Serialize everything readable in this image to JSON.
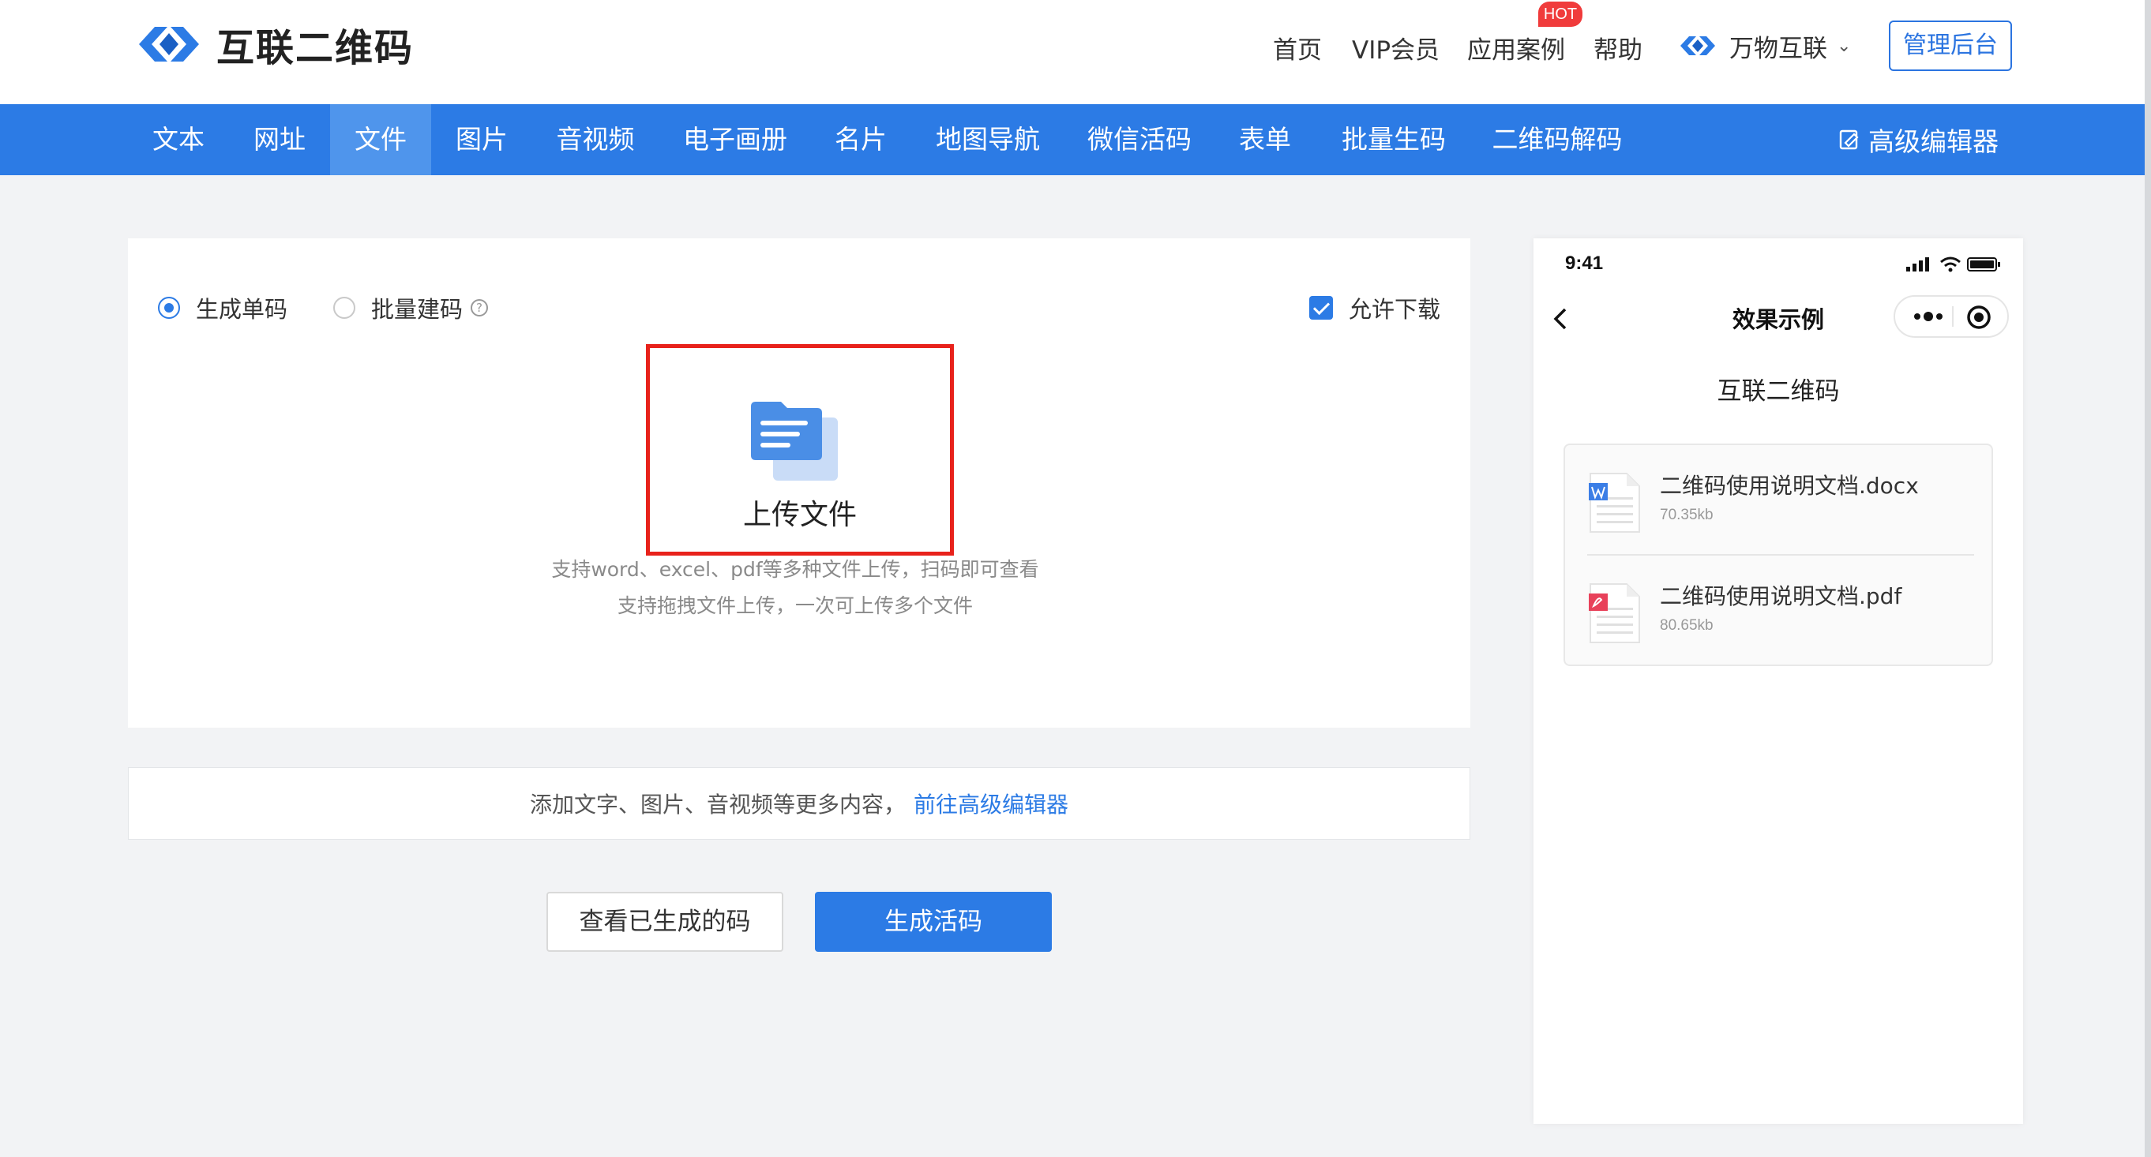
{
  "header": {
    "logo_text": "互联二维码",
    "nav": [
      "首页",
      "VIP会员",
      "应用案例",
      "帮助"
    ],
    "hot_badge": "HOT",
    "brand2": "万物互联",
    "admin_button": "管理后台"
  },
  "tabs": {
    "items": [
      "文本",
      "网址",
      "文件",
      "图片",
      "音视频",
      "电子画册",
      "名片",
      "地图导航",
      "微信活码",
      "表单",
      "批量生码",
      "二维码解码"
    ],
    "active": "文件",
    "advanced_editor": "高级编辑器"
  },
  "upload": {
    "radio_single": "生成单码",
    "radio_batch": "批量建码",
    "allow_download": "允许下载",
    "upload_label": "上传文件",
    "hint_1": "支持word、excel、pdf等多种文件上传，扫码即可查看",
    "hint_2": "支持拖拽文件上传，一次可上传多个文件"
  },
  "more": {
    "text": "添加文字、图片、音视频等更多内容，",
    "link": "前往高级编辑器"
  },
  "buttons": {
    "view_generated": "查看已生成的码",
    "generate": "生成活码"
  },
  "phone": {
    "time": "9:41",
    "title": "效果示例",
    "subtitle": "互联二维码",
    "files": [
      {
        "name": "二维码使用说明文档.docx",
        "size": "70.35kb",
        "icon": "word-file-icon"
      },
      {
        "name": "二维码使用说明文档.pdf",
        "size": "80.65kb",
        "icon": "pdf-file-icon"
      }
    ]
  },
  "colors": {
    "primary": "#2c7be5",
    "active_tab": "#4f95ec",
    "highlight_border": "#e8221b",
    "hot": "#f03b3b"
  }
}
